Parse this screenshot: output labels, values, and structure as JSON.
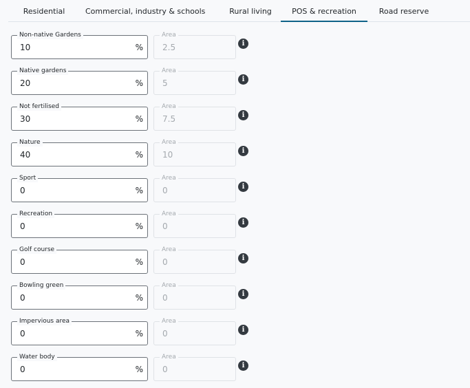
{
  "tabs": [
    {
      "label": "Residential",
      "active": false
    },
    {
      "label": "Commercial, industry & schools",
      "active": false
    },
    {
      "label": "Rural living",
      "active": false
    },
    {
      "label": "POS & recreation",
      "active": true
    },
    {
      "label": "Road reserve",
      "active": false
    }
  ],
  "accent_color": "#0f6389",
  "area_label": "Area",
  "unit": "%",
  "info_glyph": "i",
  "rows": [
    {
      "label": "Non-native Gardens",
      "percent": "10",
      "area": "2.5"
    },
    {
      "label": "Native gardens",
      "percent": "20",
      "area": "5"
    },
    {
      "label": "Not fertilised",
      "percent": "30",
      "area": "7.5"
    },
    {
      "label": "Nature",
      "percent": "40",
      "area": "10"
    },
    {
      "label": "Sport",
      "percent": "0",
      "area": "0"
    },
    {
      "label": "Recreation",
      "percent": "0",
      "area": "0"
    },
    {
      "label": "Golf course",
      "percent": "0",
      "area": "0"
    },
    {
      "label": "Bowling green",
      "percent": "0",
      "area": "0"
    },
    {
      "label": "Impervious area",
      "percent": "0",
      "area": "0"
    },
    {
      "label": "Water body",
      "percent": "0",
      "area": "0"
    }
  ]
}
